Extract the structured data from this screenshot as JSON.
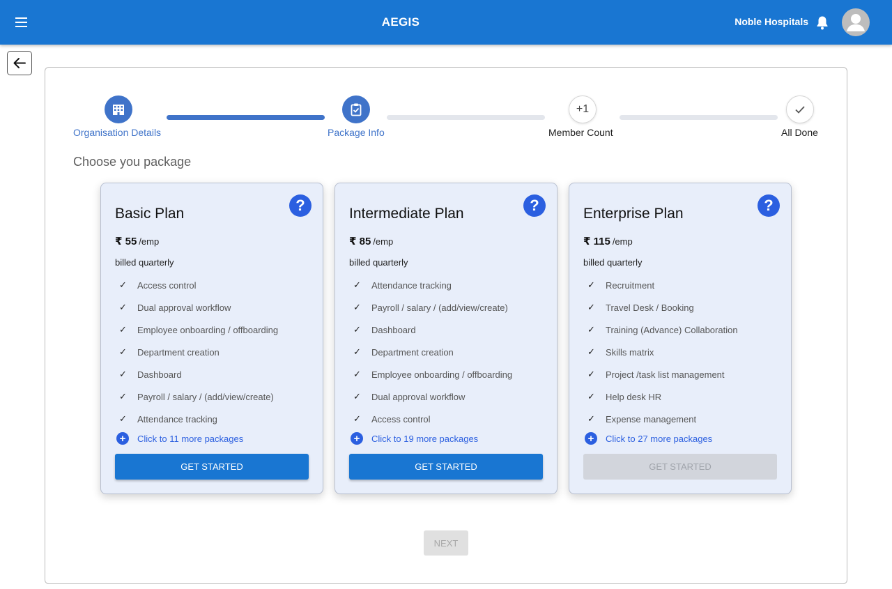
{
  "app": {
    "title": "AEGIS",
    "org_name": "Noble Hospitals"
  },
  "icons": {
    "menu": "menu-icon",
    "bell": "bell-icon",
    "avatar": "user-avatar-icon",
    "back": "arrow-left-icon"
  },
  "stepper": {
    "steps": [
      {
        "label": "Organisation Details",
        "icon": "building-icon",
        "state": "completed"
      },
      {
        "label": "Package Info",
        "icon": "clipboard-check-icon",
        "state": "active"
      },
      {
        "label": "Member Count",
        "icon_text": "+1",
        "state": "pending"
      },
      {
        "label": "All Done",
        "icon_text": "✓",
        "state": "pending"
      }
    ]
  },
  "section_title": "Choose you package",
  "plans": [
    {
      "name": "Basic Plan",
      "currency": "₹",
      "price": "55",
      "per": "/emp",
      "billing": "billed quarterly",
      "features": [
        "Access control",
        "Dual approval workflow",
        "Employee onboarding / offboarding",
        "Department creation",
        "Dashboard",
        "Payroll / salary / (add/view/create)",
        "Attendance tracking"
      ],
      "more": "Click to 11 more packages",
      "button": "GET STARTED",
      "button_enabled": true
    },
    {
      "name": "Intermediate Plan",
      "currency": "₹",
      "price": "85",
      "per": "/emp",
      "billing": "billed quarterly",
      "features": [
        "Attendance tracking",
        "Payroll / salary / (add/view/create)",
        "Dashboard",
        "Department creation",
        "Employee onboarding / offboarding",
        "Dual approval workflow",
        "Access control"
      ],
      "more": "Click to 19 more packages",
      "button": "GET STARTED",
      "button_enabled": true
    },
    {
      "name": "Enterprise Plan",
      "currency": "₹",
      "price": "115",
      "per": "/emp",
      "billing": "billed quarterly",
      "features": [
        "Recruitment",
        "Travel Desk / Booking",
        "Training (Advance) Collaboration",
        "Skills matrix",
        "Project /task list management",
        "Help desk HR",
        "Expense management"
      ],
      "more": "Click to 27 more packages",
      "button": "GET STARTED",
      "button_enabled": false
    }
  ],
  "next_label": "NEXT",
  "colors": {
    "primary": "#1976d2",
    "step_active": "#3f73c9",
    "link": "#2b5fe0",
    "card_bg": "#e8eefa"
  }
}
